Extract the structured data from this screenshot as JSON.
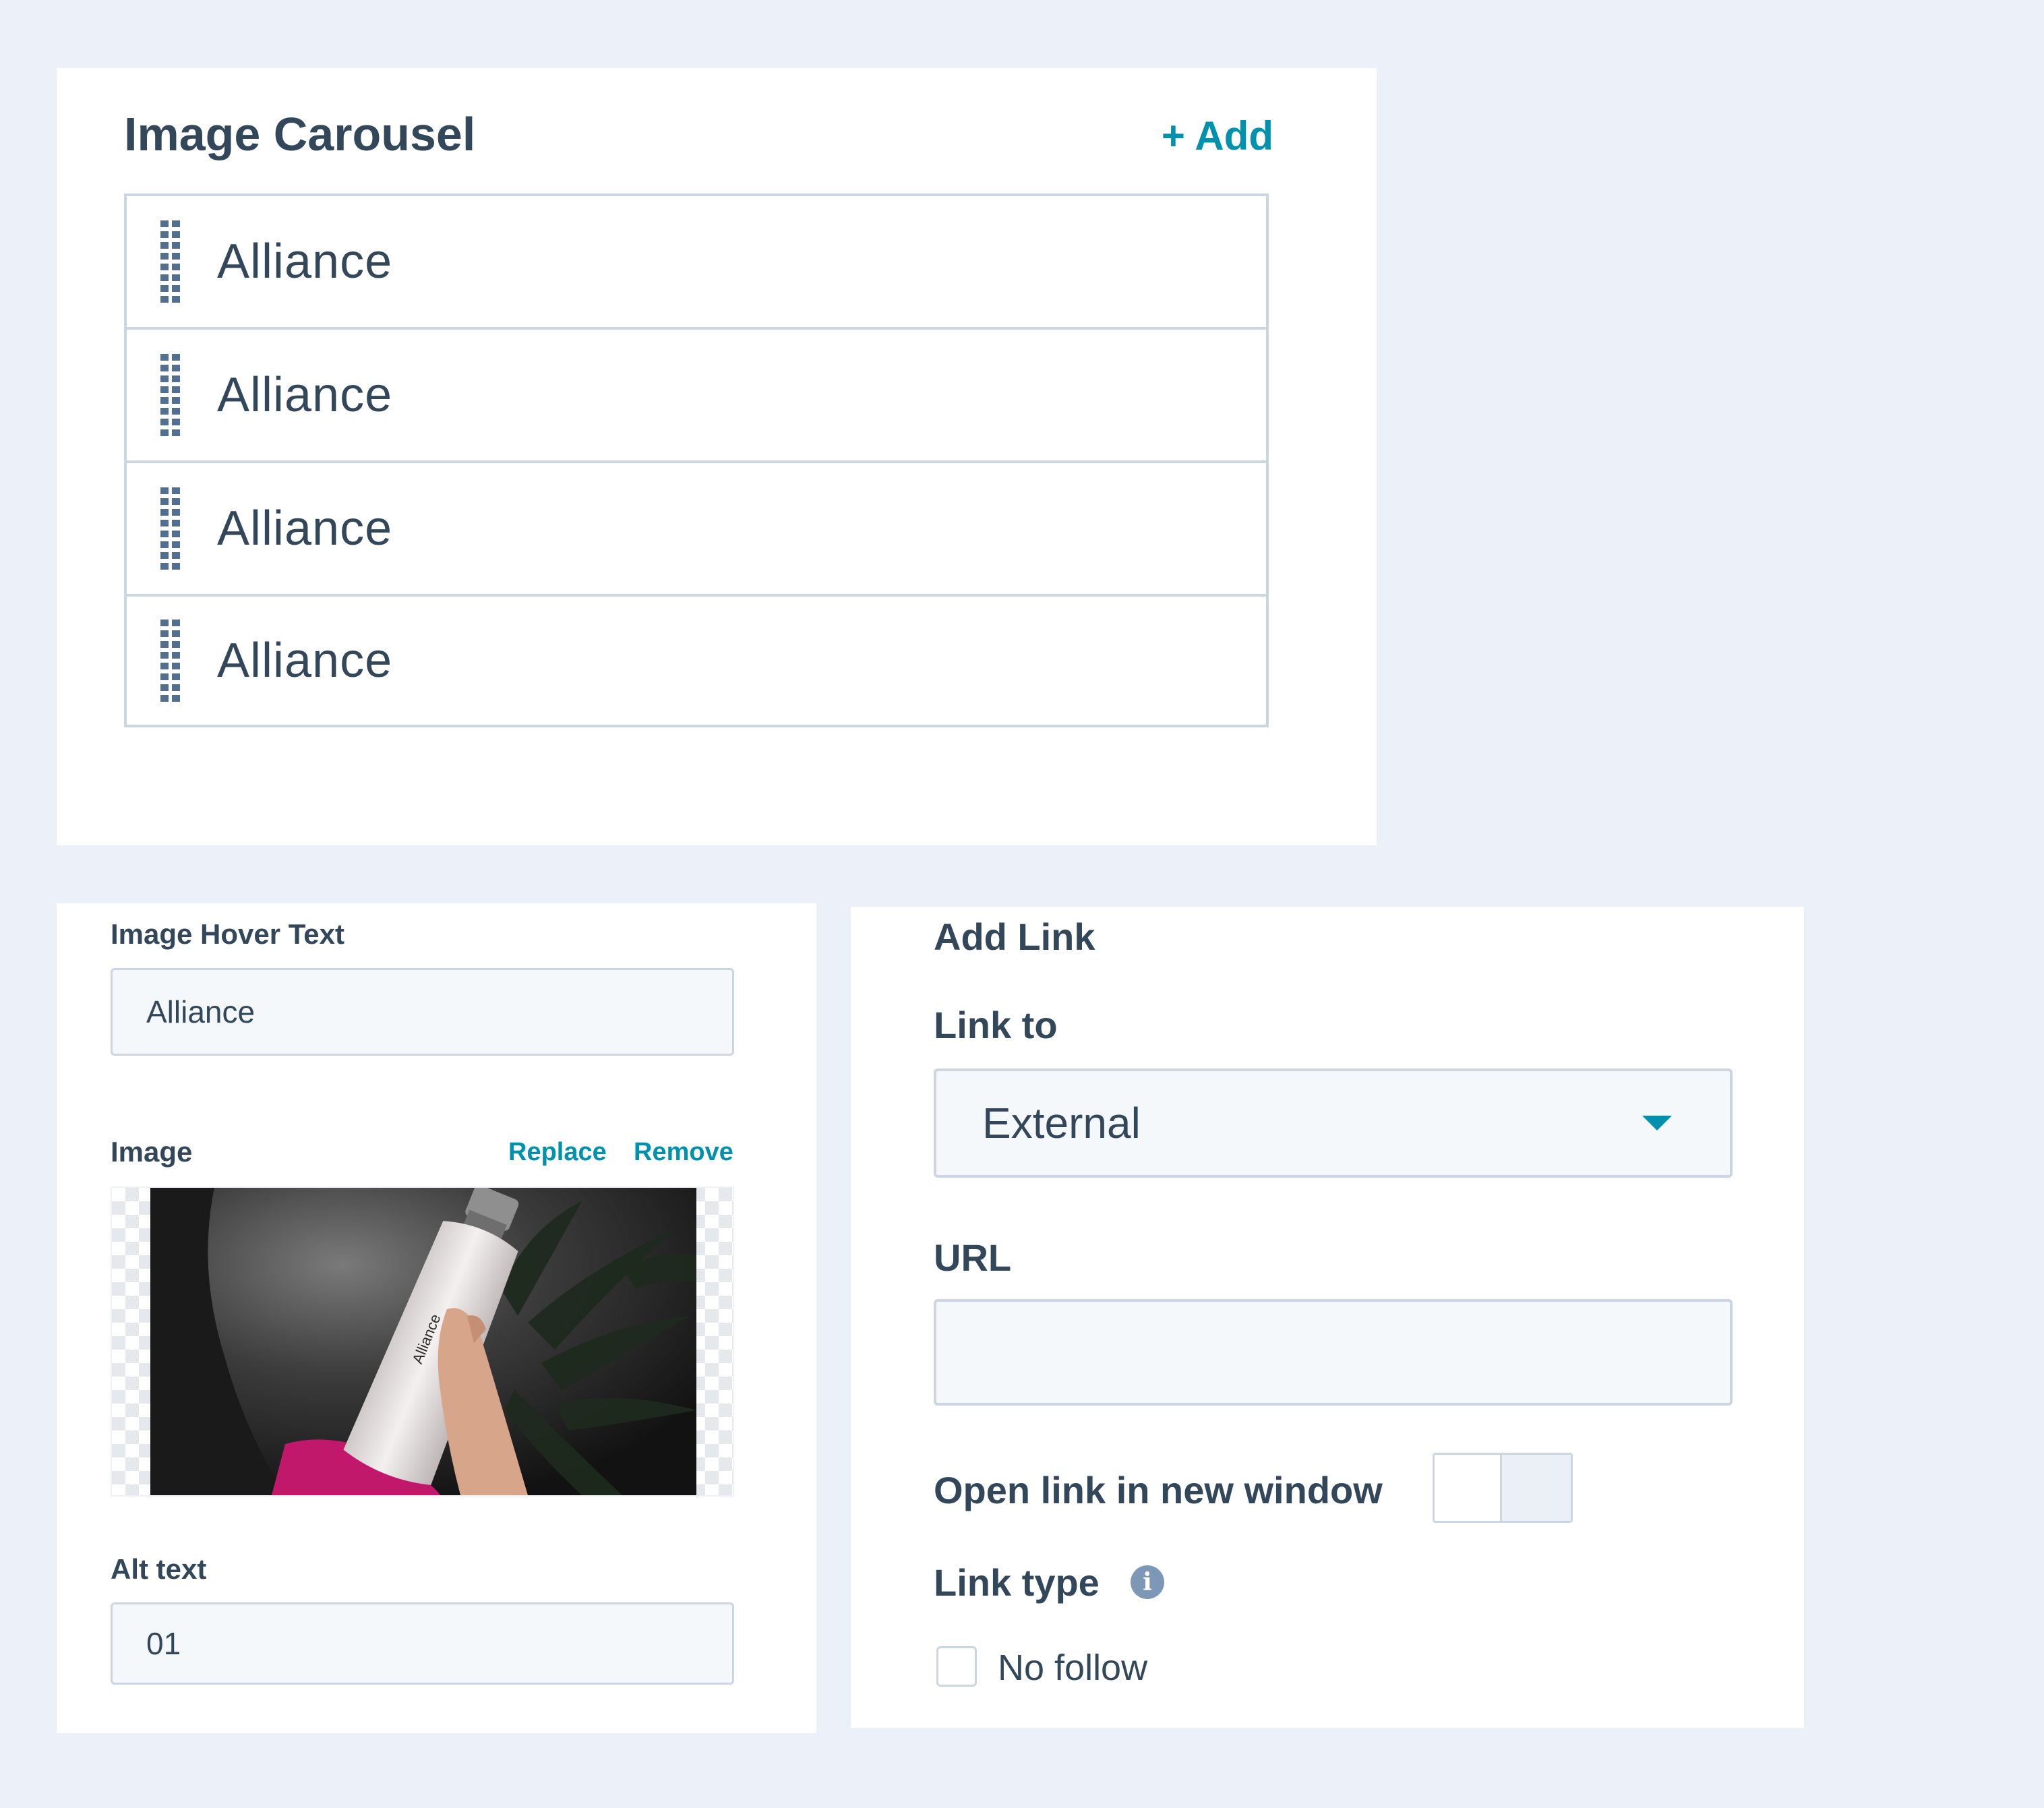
{
  "carousel": {
    "title": "Image Carousel",
    "add_label": "+ Add",
    "items": [
      {
        "label": "Alliance"
      },
      {
        "label": "Alliance"
      },
      {
        "label": "Alliance"
      },
      {
        "label": "Alliance"
      }
    ]
  },
  "image_form": {
    "hover_text_label": "Image Hover Text",
    "hover_text_value": "Alliance",
    "image_label": "Image",
    "replace_label": "Replace",
    "remove_label": "Remove",
    "photo_caption": "Alliance",
    "alt_text_label": "Alt text",
    "alt_text_value": "01"
  },
  "link_form": {
    "title": "Add Link",
    "link_to_label": "Link to",
    "link_to_value": "External",
    "url_label": "URL",
    "url_value": "",
    "new_window_label": "Open link in new window",
    "new_window_enabled": false,
    "link_type_label": "Link type",
    "no_follow_label": "No follow",
    "no_follow_checked": false
  },
  "colors": {
    "background": "#ecf0f8",
    "text": "#33475b",
    "accent": "#0091ae",
    "border": "#cbd6e2",
    "field_bg": "#f5f8fa"
  },
  "icons": [
    "drag-handle-icon",
    "caret-down-icon",
    "info-icon",
    "image-photo"
  ]
}
